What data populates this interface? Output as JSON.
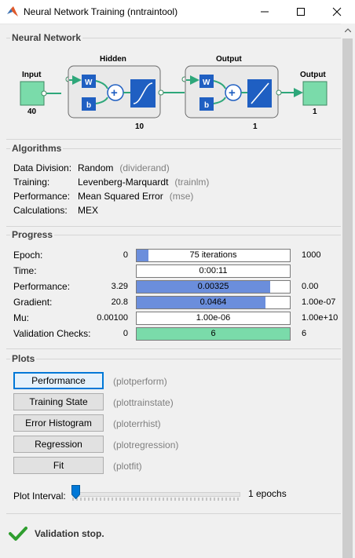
{
  "window": {
    "title": "Neural Network Training (nntraintool)"
  },
  "network": {
    "section_title": "Neural Network",
    "input_label": "Input",
    "input_size": "40",
    "hidden_label": "Hidden",
    "hidden_size": "10",
    "output_layer_label": "Output",
    "output_layer_size": "1",
    "output_label": "Output",
    "output_size": "1",
    "weight_symbol": "W",
    "bias_symbol": "b"
  },
  "algorithms": {
    "section_title": "Algorithms",
    "rows": [
      {
        "label": "Data Division:",
        "value": "Random",
        "hint": "(dividerand)"
      },
      {
        "label": "Training:",
        "value": "Levenberg-Marquardt",
        "hint": "(trainlm)"
      },
      {
        "label": "Performance:",
        "value": "Mean Squared Error",
        "hint": "(mse)"
      },
      {
        "label": "Calculations:",
        "value": "MEX",
        "hint": ""
      }
    ]
  },
  "progress": {
    "section_title": "Progress",
    "rows": [
      {
        "label": "Epoch:",
        "min": "0",
        "value": "75 iterations",
        "max": "1000",
        "fill": 0.075,
        "color": "blue"
      },
      {
        "label": "Time:",
        "min": "",
        "value": "0:00:11",
        "max": "",
        "fill": 0,
        "color": "blue"
      },
      {
        "label": "Performance:",
        "min": "3.29",
        "value": "0.00325",
        "max": "0.00",
        "fill": 0.87,
        "color": "blue"
      },
      {
        "label": "Gradient:",
        "min": "20.8",
        "value": "0.0464",
        "max": "1.00e-07",
        "fill": 0.84,
        "color": "blue"
      },
      {
        "label": "Mu:",
        "min": "0.00100",
        "value": "1.00e-06",
        "max": "1.00e+10",
        "fill": 0,
        "color": "blue"
      },
      {
        "label": "Validation Checks:",
        "min": "0",
        "value": "6",
        "max": "6",
        "fill": 1.0,
        "color": "green"
      }
    ]
  },
  "plots": {
    "section_title": "Plots",
    "buttons": [
      {
        "label": "Performance",
        "hint": "(plotperform)"
      },
      {
        "label": "Training State",
        "hint": "(plottrainstate)"
      },
      {
        "label": "Error Histogram",
        "hint": "(ploterrhist)"
      },
      {
        "label": "Regression",
        "hint": "(plotregression)"
      },
      {
        "label": "Fit",
        "hint": "(plotfit)"
      }
    ],
    "interval_label": "Plot Interval:",
    "interval_value": "1 epochs",
    "interval_level": 0
  },
  "status": {
    "message": "Validation stop."
  },
  "colors": {
    "accent": "#0078d7",
    "bar_blue": "#6b8edc",
    "bar_green": "#7adbaa",
    "layer_green": "#7adbaa",
    "weight_blue": "#1f5fc2"
  }
}
